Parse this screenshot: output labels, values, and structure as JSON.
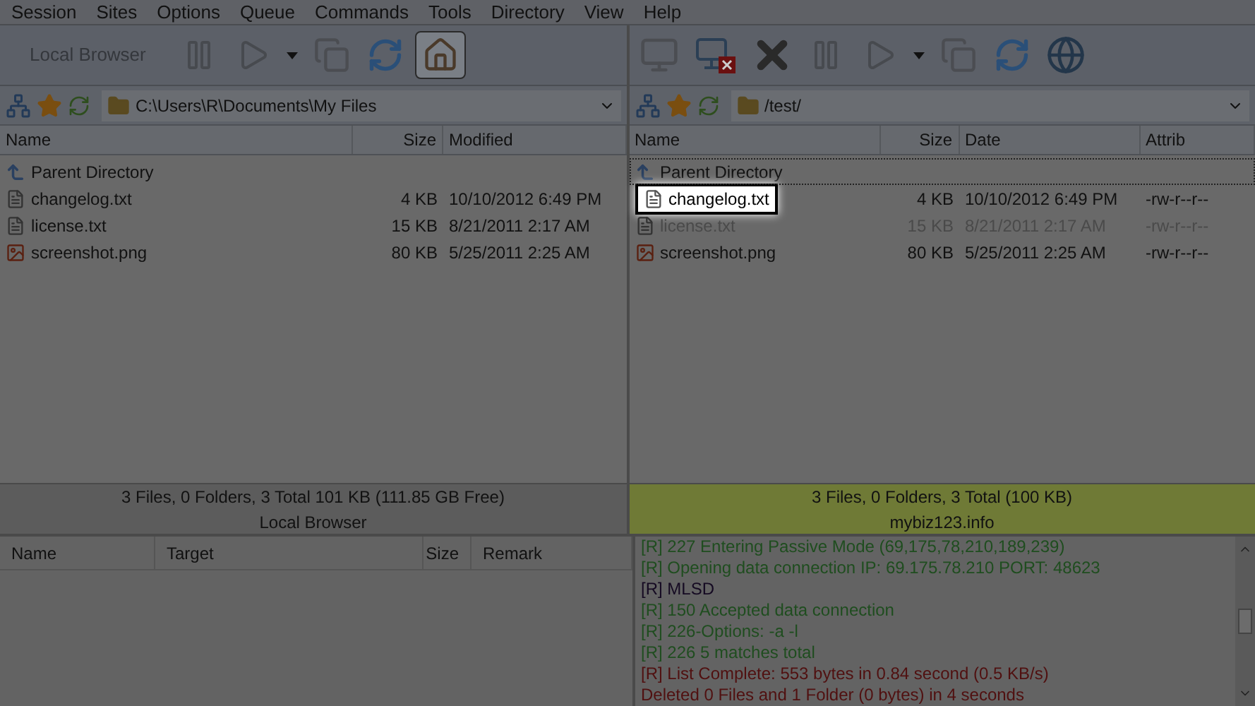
{
  "menu": [
    "Session",
    "Sites",
    "Options",
    "Queue",
    "Commands",
    "Tools",
    "Directory",
    "View",
    "Help"
  ],
  "local": {
    "toolbar": [
      {
        "kind": "label",
        "label": "Local Browser",
        "disabled": true,
        "pressed": false
      },
      {
        "kind": "pause",
        "disabled": true,
        "pressed": false
      },
      {
        "kind": "play",
        "disabled": true,
        "pressed": false
      },
      {
        "kind": "caret",
        "disabled": false,
        "pressed": false
      },
      {
        "kind": "transfer",
        "disabled": true,
        "pressed": false
      },
      {
        "kind": "refresh",
        "disabled": false,
        "pressed": false
      },
      {
        "kind": "home",
        "disabled": false,
        "pressed": true
      }
    ],
    "path": "C:\\Users\\R\\Documents\\My Files",
    "columns": [
      "Name",
      "Size",
      "Modified"
    ],
    "rows": [
      {
        "kind": "up",
        "name": "Parent Directory",
        "size": "",
        "date": "",
        "focused": false,
        "highlighted": false,
        "faded": false
      },
      {
        "kind": "text",
        "name": "changelog.txt",
        "size": "4 KB",
        "date": "10/10/2012 6:49 PM",
        "focused": false,
        "highlighted": false,
        "faded": false
      },
      {
        "kind": "text",
        "name": "license.txt",
        "size": "15 KB",
        "date": "8/21/2011 2:17 AM",
        "focused": false,
        "highlighted": false,
        "faded": false
      },
      {
        "kind": "image",
        "name": "screenshot.png",
        "size": "80 KB",
        "date": "5/25/2011 2:25 AM",
        "focused": false,
        "highlighted": false,
        "faded": false
      }
    ],
    "status": "3 Files, 0 Folders, 3 Total 101 KB (111.85 GB Free)",
    "title": "Local Browser",
    "connected": false
  },
  "remote": {
    "toolbar": [
      {
        "kind": "connect",
        "disabled": true,
        "pressed": false
      },
      {
        "kind": "disconnect",
        "disabled": false,
        "pressed": false
      },
      {
        "kind": "stop",
        "disabled": false,
        "pressed": false
      },
      {
        "kind": "pause",
        "disabled": true,
        "pressed": false
      },
      {
        "kind": "play",
        "disabled": true,
        "pressed": false
      },
      {
        "kind": "caret",
        "disabled": false,
        "pressed": false
      },
      {
        "kind": "transfer",
        "disabled": true,
        "pressed": false
      },
      {
        "kind": "refresh",
        "disabled": false,
        "pressed": false
      },
      {
        "kind": "globe",
        "disabled": false,
        "pressed": false
      }
    ],
    "path": "/test/",
    "columns": [
      "Name",
      "Size",
      "Date",
      "Attrib"
    ],
    "rows": [
      {
        "kind": "up",
        "name": "Parent Directory",
        "size": "",
        "date": "",
        "attrib": "",
        "focused": true,
        "highlighted": false,
        "faded": false
      },
      {
        "kind": "text",
        "name": "changelog.txt",
        "size": "4 KB",
        "date": "10/10/2012 6:49 PM",
        "attrib": "-rw-r--r--",
        "focused": false,
        "highlighted": true,
        "faded": false
      },
      {
        "kind": "text",
        "name": "license.txt",
        "size": "15 KB",
        "date": "8/21/2011 2:17 AM",
        "attrib": "-rw-r--r--",
        "focused": false,
        "highlighted": false,
        "faded": true
      },
      {
        "kind": "image",
        "name": "screenshot.png",
        "size": "80 KB",
        "date": "5/25/2011 2:25 AM",
        "attrib": "-rw-r--r--",
        "focused": false,
        "highlighted": false,
        "faded": false
      }
    ],
    "status": "3 Files, 0 Folders, 3 Total (100 KB)",
    "title": "mybiz123.info",
    "connected": true
  },
  "queue": {
    "columns": [
      "Name",
      "Target",
      "Size",
      "Remark"
    ]
  },
  "log": [
    {
      "kind": "reply",
      "text": "[R] 227 Entering Passive Mode (69,175,78,210,189,239)"
    },
    {
      "kind": "reply",
      "text": "[R] Opening data connection IP: 69.175.78.210 PORT: 48623"
    },
    {
      "kind": "command",
      "text": "[R] MLSD"
    },
    {
      "kind": "reply",
      "text": "[R] 150 Accepted data connection"
    },
    {
      "kind": "reply",
      "text": "[R] 226-Options: -a -l"
    },
    {
      "kind": "reply",
      "text": "[R] 226 5 matches total"
    },
    {
      "kind": "status",
      "text": "[R] List Complete: 553 bytes in 0.84 second (0.5 KB/s)"
    },
    {
      "kind": "status",
      "text": "Deleted 0 Files and 1 Folder (0 bytes) in 4 seconds"
    }
  ]
}
